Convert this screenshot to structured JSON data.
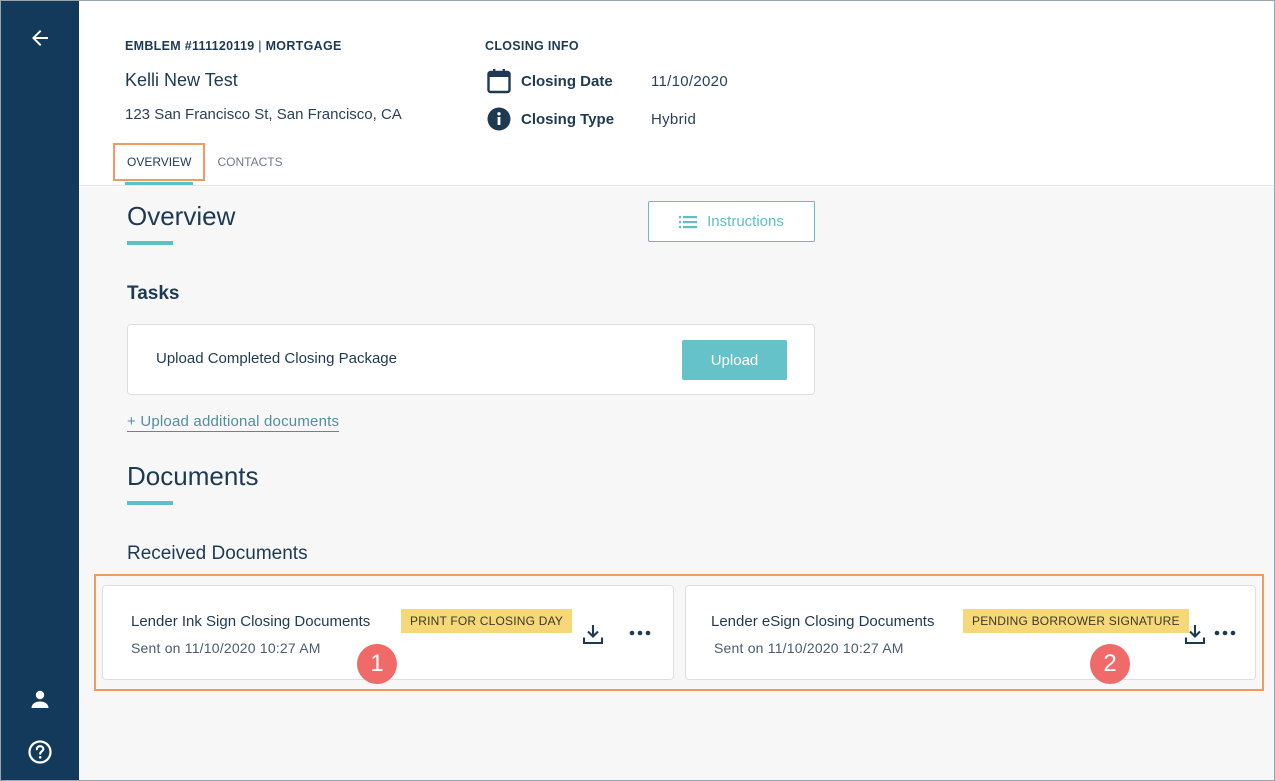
{
  "sidebar": {
    "back_icon": "arrow-left-icon",
    "user_icon": "user-icon",
    "help_icon": "question-circle-icon"
  },
  "header": {
    "emblem_prefix": "EMBLEM #111120119",
    "emblem_separator": " | ",
    "emblem_type": "MORTGAGE",
    "client_name": "Kelli New Test",
    "address": "123 San Francisco St, San Francisco, CA",
    "closing_info": {
      "heading": "CLOSING INFO",
      "date_label": "Closing Date",
      "date_value": "11/10/2020",
      "type_label": "Closing Type",
      "type_value": "Hybrid"
    },
    "tabs": [
      {
        "label": "OVERVIEW",
        "active": true
      },
      {
        "label": "CONTACTS",
        "active": false
      }
    ]
  },
  "overview": {
    "title": "Overview",
    "instructions_label": "Instructions"
  },
  "tasks": {
    "title": "Tasks",
    "items": [
      {
        "label": "Upload Completed Closing Package",
        "action_label": "Upload"
      }
    ],
    "upload_link": "+ Upload additional documents"
  },
  "documents": {
    "title": "Documents",
    "received_title": "Received Documents",
    "items": [
      {
        "title": "Lender Ink Sign Closing Documents",
        "badge": "PRINT FOR CLOSING DAY",
        "sent": "Sent on 11/10/2020 10:27 AM",
        "callout": "1"
      },
      {
        "title": "Lender eSign Closing Documents",
        "badge": "PENDING BORROWER SIGNATURE",
        "sent": "Sent on 11/10/2020 10:27 AM",
        "callout": "2"
      }
    ]
  },
  "colors": {
    "sidebar": "#143a5b",
    "accent": "#5cc0c7",
    "highlight": "#ef9a62",
    "badge": "#f6d878",
    "callout": "#f06a6a"
  }
}
